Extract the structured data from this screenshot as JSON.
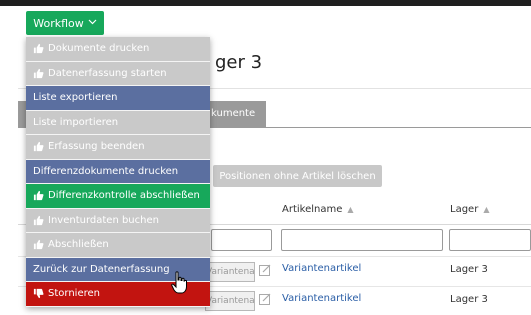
{
  "toolbar": {
    "workflow_label": "Workflow"
  },
  "page": {
    "title": "ger 3"
  },
  "tabs": [
    {
      "label": "kumente"
    }
  ],
  "actions": {
    "clear_positions_label": "Positionen ohne Artikel löschen"
  },
  "table": {
    "headers": [
      {
        "label": "Artikelname"
      },
      {
        "label": "Lager"
      }
    ],
    "rows": [
      {
        "button_text": "Variantenartikel",
        "artikelname": "Variantenartikel",
        "lager": "Lager 3"
      },
      {
        "button_text": "Variantenartikel",
        "artikelname": "Variantenartikel",
        "lager": "Lager 3"
      }
    ]
  },
  "workflow_menu": {
    "items": [
      {
        "label": "Dokumente drucken",
        "icon": "thumbs-up-icon",
        "style": "gray"
      },
      {
        "label": "Datenerfassung starten",
        "icon": "thumbs-up-icon",
        "style": "gray"
      },
      {
        "label": "Liste exportieren",
        "icon": "",
        "style": "blue"
      },
      {
        "label": "Liste importieren",
        "icon": "",
        "style": "gray"
      },
      {
        "label": "Erfassung beenden",
        "icon": "thumbs-up-icon",
        "style": "gray"
      },
      {
        "label": "Differenzdokumente drucken",
        "icon": "",
        "style": "blue"
      },
      {
        "label": "Differenzkontrolle abschließen",
        "icon": "thumbs-up-icon",
        "style": "green"
      },
      {
        "label": "Inventurdaten buchen",
        "icon": "thumbs-up-icon",
        "style": "gray"
      },
      {
        "label": "Abschließen",
        "icon": "thumbs-up-icon",
        "style": "gray"
      },
      {
        "label": "Zurück zur Datenerfassung",
        "icon": "",
        "style": "blue"
      },
      {
        "label": "Stornieren",
        "icon": "thumbs-down-icon",
        "style": "red"
      }
    ]
  },
  "colors": {
    "workflow_green": "#17a85b",
    "menu_gray": "#c9c9c9",
    "menu_blue": "#5b6fa0",
    "menu_red": "#c21410",
    "link_blue": "#2a5ea6",
    "tab_gray": "#9a9a9a"
  }
}
